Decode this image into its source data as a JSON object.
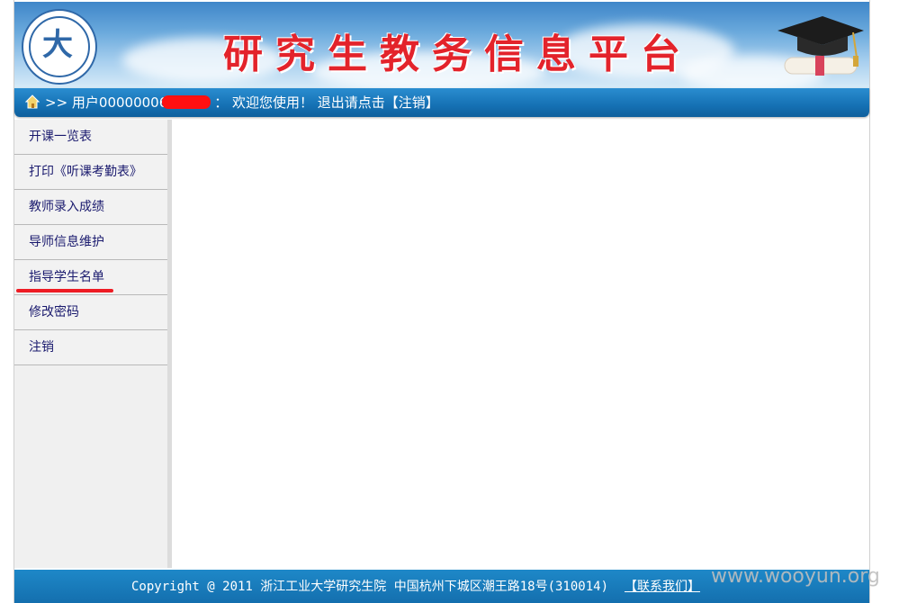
{
  "header": {
    "title": "研究生教务信息平台",
    "logo_glyph": "大"
  },
  "userbar": {
    "prefix": ">> 用户00000006",
    "suffix": "：  欢迎您使用！ 退出请点击【注销】"
  },
  "sidebar": {
    "items": [
      {
        "label": "开课一览表"
      },
      {
        "label": "打印《听课考勤表》"
      },
      {
        "label": "教师录入成绩"
      },
      {
        "label": "导师信息维护"
      },
      {
        "label": "指导学生名单"
      },
      {
        "label": "修改密码"
      },
      {
        "label": "注销"
      }
    ]
  },
  "footer": {
    "text": "Copyright @ 2011 浙江工业大学研究生院   中国杭州下城区潮王路18号(310014)",
    "link": "【联系我们】"
  },
  "watermark": "www.wooyun.org",
  "colors": {
    "title_red": "#e3232b",
    "bar_blue": "#1571b4",
    "annotation_red": "#ee1c24"
  }
}
